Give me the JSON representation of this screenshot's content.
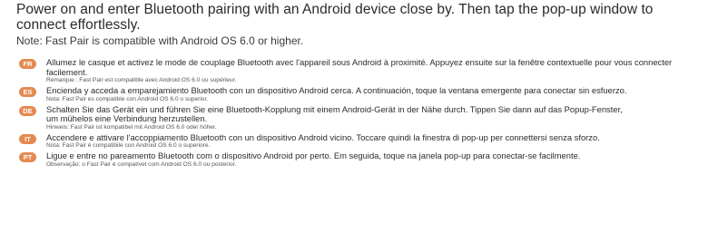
{
  "heading": "Power on and enter Bluetooth pairing with an Android device close by. Then tap the pop-up window to connect effortlessly.",
  "note": "Note: Fast Pair is compatible with Android OS 6.0 or higher.",
  "languages": [
    {
      "code": "FR",
      "text": "Allumez le casque et activez le mode de couplage Bluetooth avec l'appareil sous Android à proximité. Appuyez ensuite sur la fenêtre contextuelle pour vous connecter facilement.",
      "note": "Remarque : Fast Pair est compatible avec Android OS 6.0 ou supérieur."
    },
    {
      "code": "ES",
      "text": "Encienda y acceda a emparejamiento Bluetooth con un dispositivo Android cerca. A continuación, toque la ventana emergente para conectar sin esfuerzo.",
      "note": "Nota: Fast Pair es compatible con Android OS 6.0 o superior."
    },
    {
      "code": "DE",
      "text": "Schalten Sie das Gerät ein und führen Sie eine Bluetooth-Kopplung mit einem Android-Gerät in der Nähe durch. Tippen Sie dann auf das Popup-Fenster, um mühelos eine Verbindung herzustellen.",
      "note": "Hinweis: Fast Pair ist kompatibel mit Android OS 6.0 oder höher."
    },
    {
      "code": "IT",
      "text": "Accendere e attivare l'accoppiamento Bluetooth con un dispositivo Android vicino. Toccare quindi la finestra di pop-up per connettersi senza sforzo.",
      "note": "Nota: Fast Pair è compatibile con Android OS 6.0 o superiore."
    },
    {
      "code": "PT",
      "text": "Ligue e entre no pareamento Bluetooth com o dispositivo Android por perto. Em seguida, toque na janela pop-up para conectar-se facilmente.",
      "note": "Observação: o Fast Pair é compatível com Android OS 6.0 ou posterior."
    }
  ],
  "colors": {
    "badge": "#e48a51",
    "text": "#2b2b2b"
  }
}
